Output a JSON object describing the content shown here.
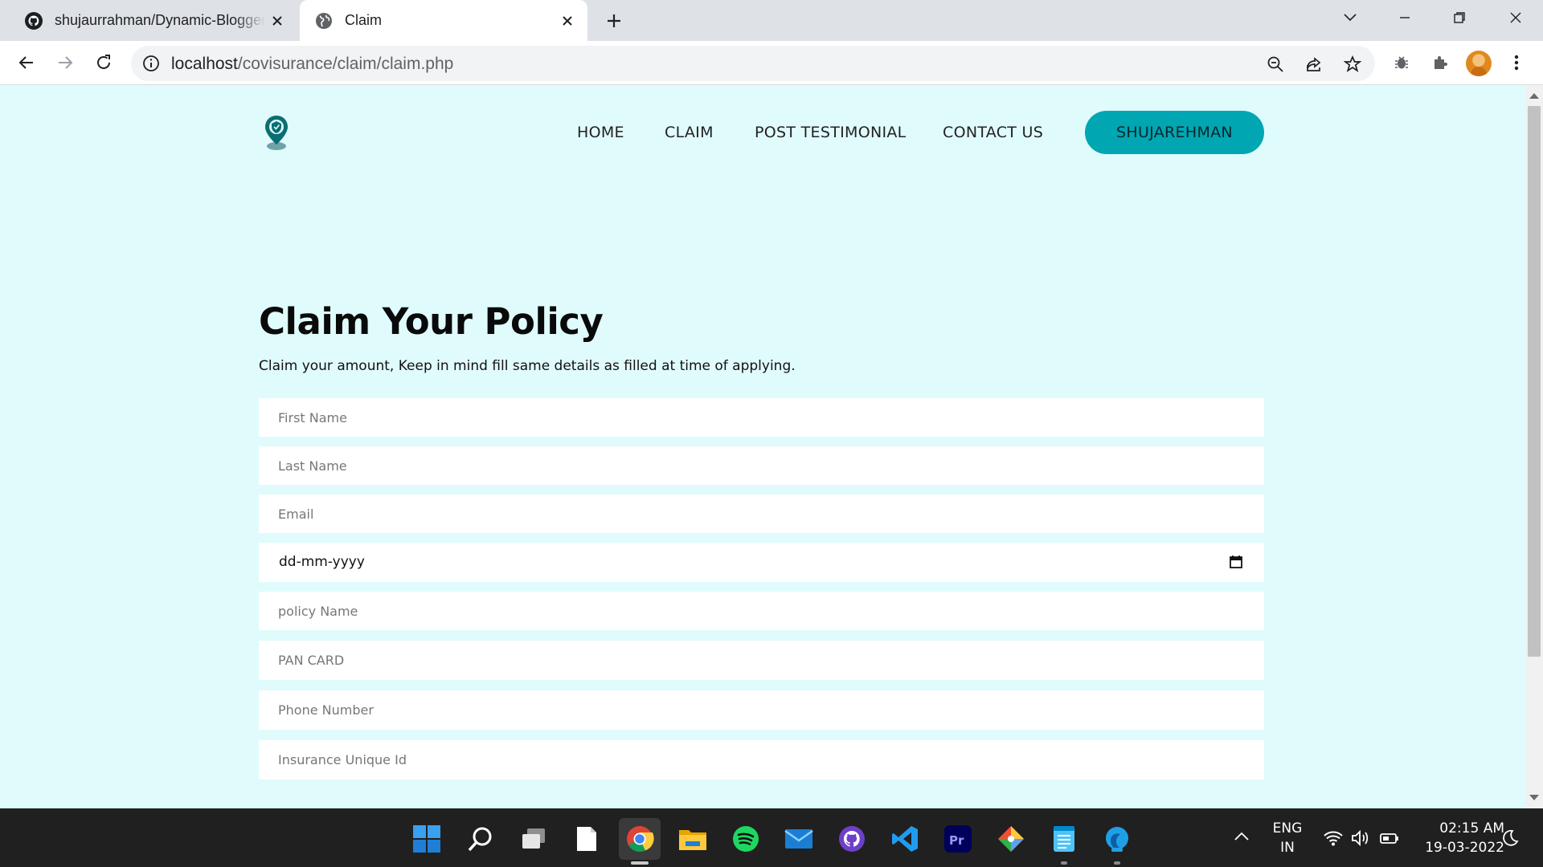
{
  "browser": {
    "tabs": [
      {
        "title": "shujaurrahman/Dynamic-Blogger",
        "favicon": "github-icon",
        "active": false
      },
      {
        "title": "Claim",
        "favicon": "globe-icon",
        "active": true
      }
    ],
    "url_host": "localhost",
    "url_path": "/covisurance/claim/claim.php"
  },
  "nav": {
    "home": "HOME",
    "claim": "CLAIM",
    "testimonial": "POST TESTIMONIAL",
    "contact": "CONTACT US",
    "user": "SHUJAREHMAN"
  },
  "form": {
    "title": "Claim Your Policy",
    "subtitle": "Claim your amount, Keep in mind fill same details as filled at time of applying.",
    "first_name_placeholder": "First Name",
    "last_name_placeholder": "Last Name",
    "email_placeholder": "Email",
    "date_value": "dd-mm-yyyy",
    "policy_name_placeholder": "policy Name",
    "pan_placeholder": "PAN CARD",
    "phone_placeholder": "Phone Number",
    "insurance_id_placeholder": "Insurance Unique Id"
  },
  "taskbar": {
    "apps": [
      "windows-start",
      "search",
      "task-view",
      "notepad",
      "chrome",
      "file-explorer",
      "spotify",
      "mail",
      "github-desktop",
      "vscode",
      "premiere-pro",
      "git-tools",
      "notes",
      "edge-dev"
    ],
    "lang_line1": "ENG",
    "lang_line2": "IN",
    "time": "02:15 AM",
    "date": "19-03-2022"
  },
  "colors": {
    "page_bg": "#e0fbfc",
    "accent": "#00a6b2",
    "taskbar": "#202020"
  }
}
